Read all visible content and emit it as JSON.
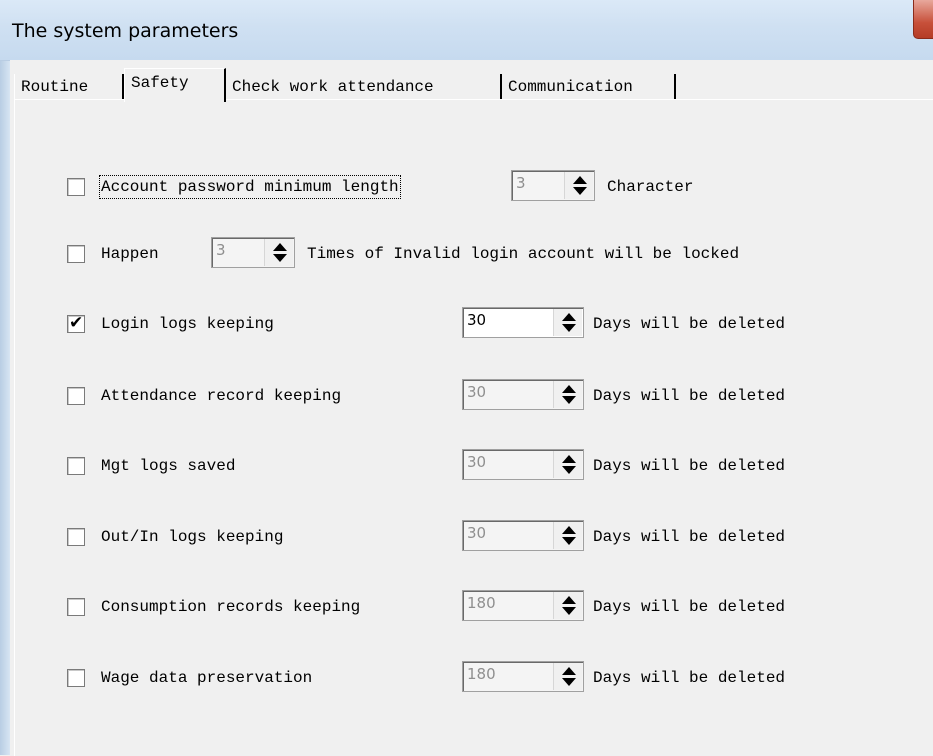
{
  "window": {
    "title": "The system parameters"
  },
  "tabs": [
    {
      "label": "Routine",
      "active": false
    },
    {
      "label": "Safety",
      "active": true
    },
    {
      "label": "Check work attendance",
      "active": false
    },
    {
      "label": "Communication",
      "active": false
    }
  ],
  "settings": {
    "password_min": {
      "checked": false,
      "label": "Account password minimum length",
      "value": "3",
      "suffix": "Character"
    },
    "invalid_login": {
      "checked": false,
      "label": "Happen",
      "value": "3",
      "suffix": "Times of Invalid login account will be locked"
    },
    "login_logs": {
      "checked": true,
      "label": "Login logs keeping",
      "value": "30",
      "suffix": "Days will be deleted"
    },
    "attendance_record": {
      "checked": false,
      "label": "Attendance record keeping",
      "value": "30",
      "suffix": "Days will be deleted"
    },
    "mgt_logs": {
      "checked": false,
      "label": "Mgt logs saved",
      "value": "30",
      "suffix": "Days will be deleted"
    },
    "out_in_logs": {
      "checked": false,
      "label": "Out/In logs keeping",
      "value": "30",
      "suffix": "Days will be deleted"
    },
    "consumption_records": {
      "checked": false,
      "label": "Consumption records keeping",
      "value": "180",
      "suffix": "Days will be deleted"
    },
    "wage_data": {
      "checked": false,
      "label": "Wage data preservation",
      "value": "180",
      "suffix": "Days will be deleted"
    }
  },
  "icons": {
    "checkmark": "check-mark",
    "spin_up": "triangle-up",
    "spin_down": "triangle-down",
    "close": "close-icon"
  },
  "colors": {
    "titlebar": "#cfe0f2",
    "panel": "#f0f0f0",
    "close_button": "#c7503a",
    "disabled_text": "#8f8f8f"
  }
}
